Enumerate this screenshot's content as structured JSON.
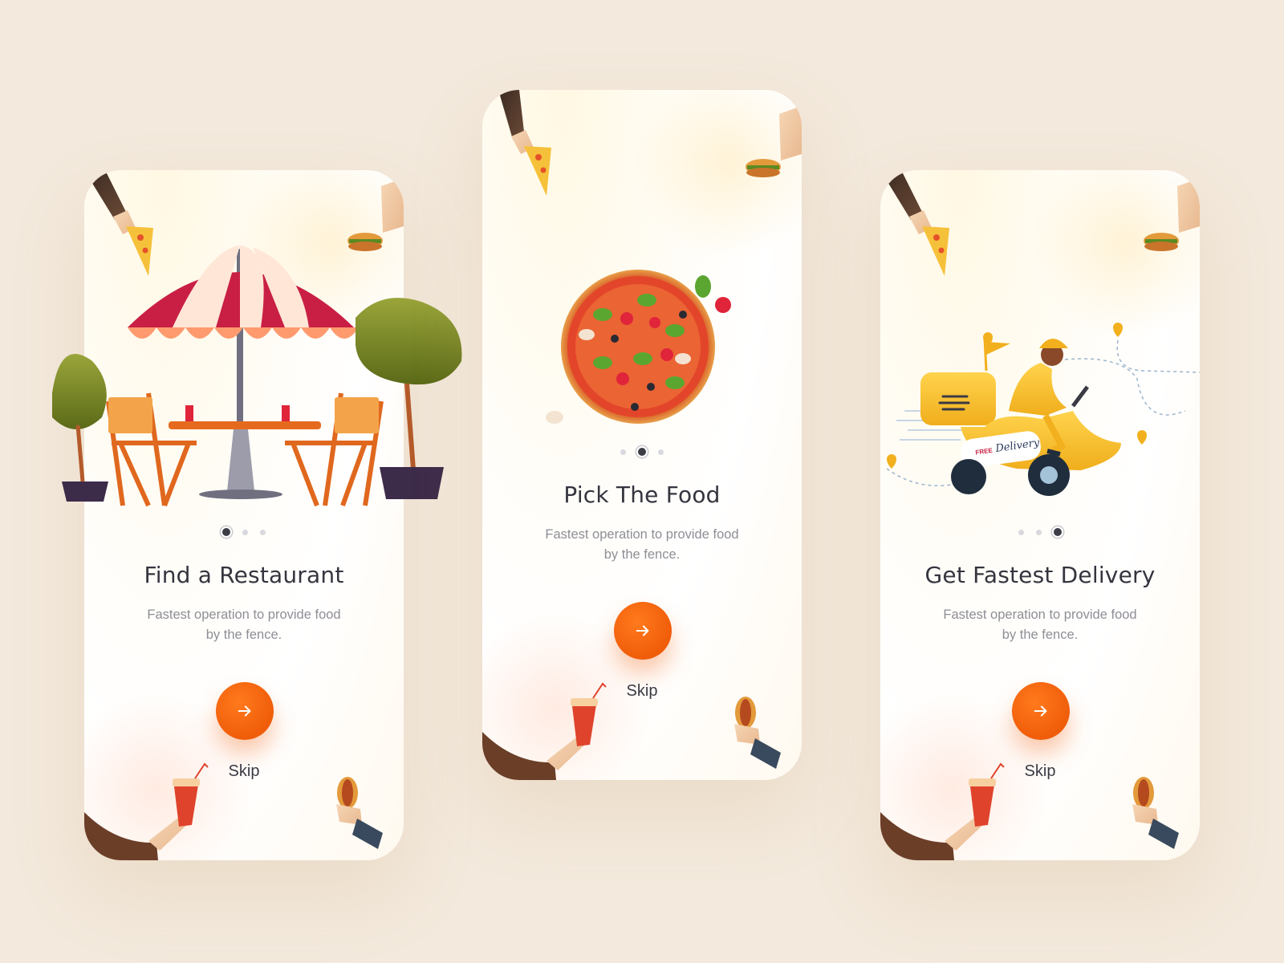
{
  "screens": [
    {
      "title": "Find a Restaurant",
      "description_line1": "Fastest operation to provide food",
      "description_line2": "by the fence.",
      "skip_label": "Skip",
      "active_dot": 1,
      "illustration": "restaurant-table-umbrella"
    },
    {
      "title": "Pick The Food",
      "description_line1": "Fastest operation to provide food",
      "description_line2": "by the fence.",
      "skip_label": "Skip",
      "active_dot": 2,
      "illustration": "pizza"
    },
    {
      "title": "Get Fastest Delivery",
      "description_line1": "Fastest operation to provide food",
      "description_line2": "by the fence.",
      "skip_label": "Skip",
      "active_dot": 3,
      "illustration": "delivery-scooter"
    }
  ],
  "scooter_badge": "FREE",
  "scooter_text": "Delivery",
  "colors": {
    "background": "#f3e9dc",
    "accent": "#f05d0a",
    "title": "#35353f",
    "description": "#8e8e96",
    "dot_active": "#3d3d48",
    "dot_inactive": "#d8d8de"
  },
  "icons": {
    "next": "arrow-right-icon"
  }
}
